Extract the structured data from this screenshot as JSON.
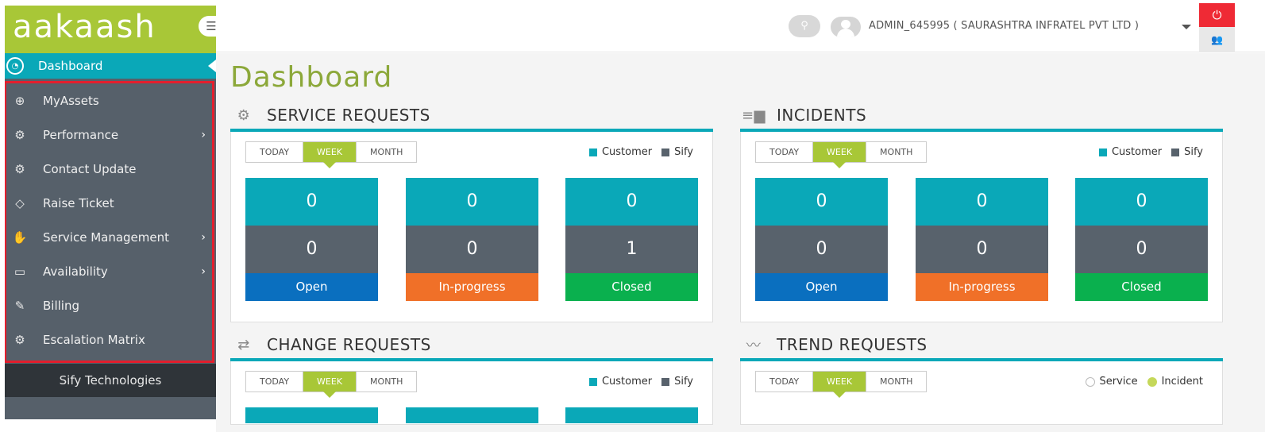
{
  "brand": {
    "logo_text": "aakaash",
    "footer": "Sify Technologies"
  },
  "sidebar": {
    "dashboard_label": "Dashboard",
    "items": [
      {
        "label": "MyAssets",
        "icon": "asset-icon",
        "glyph": "⊕",
        "has_submenu": false
      },
      {
        "label": "Performance",
        "icon": "gear-icon",
        "glyph": "⚙",
        "has_submenu": true
      },
      {
        "label": "Contact Update",
        "icon": "gear-icon",
        "glyph": "⚙",
        "has_submenu": false
      },
      {
        "label": "Raise Ticket",
        "icon": "ticket-icon",
        "glyph": "◇",
        "has_submenu": false
      },
      {
        "label": "Service Management",
        "icon": "service-hand-icon",
        "glyph": "✋",
        "has_submenu": true
      },
      {
        "label": "Availability",
        "icon": "monitor-chart-icon",
        "glyph": "▭",
        "has_submenu": true
      },
      {
        "label": "Billing",
        "icon": "billing-icon",
        "glyph": "✎",
        "has_submenu": false
      },
      {
        "label": "Escalation Matrix",
        "icon": "gear-icon",
        "glyph": "⚙",
        "has_submenu": false
      }
    ],
    "chevron": "›"
  },
  "header": {
    "user": "ADMIN_645995 ( SAURASHTRA INFRATEL PVT LTD )",
    "icons": {
      "search": "search-icon",
      "power": "power-icon",
      "users": "users-icon",
      "menu": "hamburger-icon"
    }
  },
  "main": {
    "title": "Dashboard",
    "tabs": [
      "TODAY",
      "WEEK",
      "MONTH"
    ],
    "active_tab": "WEEK",
    "legend_a": [
      "Customer",
      "Sify"
    ],
    "legend_b": [
      "Service",
      "Incident"
    ],
    "service_requests": {
      "title": "SERVICE REQUESTS",
      "tiles": [
        {
          "customer": "0",
          "sify": "0",
          "label": "Open"
        },
        {
          "customer": "0",
          "sify": "0",
          "label": "In-progress"
        },
        {
          "customer": "0",
          "sify": "1",
          "label": "Closed"
        }
      ]
    },
    "incidents": {
      "title": "INCIDENTS",
      "tiles": [
        {
          "customer": "0",
          "sify": "0",
          "label": "Open"
        },
        {
          "customer": "0",
          "sify": "0",
          "label": "In-progress"
        },
        {
          "customer": "0",
          "sify": "0",
          "label": "Closed"
        }
      ]
    },
    "change_requests": {
      "title": "CHANGE REQUESTS"
    },
    "trend_requests": {
      "title": "TREND REQUESTS"
    }
  },
  "colors": {
    "accent_green": "#a8c737",
    "teal": "#0aa8b8",
    "slate": "#58626c",
    "open": "#0a6fbf",
    "in_progress": "#f07028",
    "closed": "#0ab04e",
    "incident_dot": "#c5d85a"
  }
}
